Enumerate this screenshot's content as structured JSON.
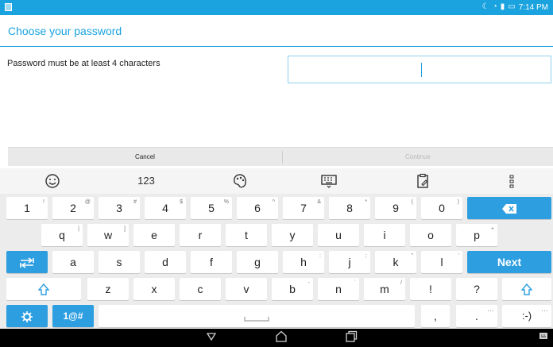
{
  "status_bar": {
    "time": "7:14 PM"
  },
  "header": {
    "title": "Choose your password"
  },
  "content": {
    "hint": "Password must be at least 4 characters"
  },
  "buttons": {
    "cancel": "Cancel",
    "continue": "Continue"
  },
  "keyboard": {
    "toolbar": {
      "numbers": "123"
    },
    "rows": {
      "numbers": [
        {
          "label": "1",
          "hint": "!"
        },
        {
          "label": "2",
          "hint": "@"
        },
        {
          "label": "3",
          "hint": "#"
        },
        {
          "label": "4",
          "hint": "$"
        },
        {
          "label": "5",
          "hint": "%"
        },
        {
          "label": "6",
          "hint": "^"
        },
        {
          "label": "7",
          "hint": "&"
        },
        {
          "label": "8",
          "hint": "*"
        },
        {
          "label": "9",
          "hint": "("
        },
        {
          "label": "0",
          "hint": ")"
        }
      ],
      "row2": [
        {
          "label": "q",
          "hint": "|"
        },
        {
          "label": "w",
          "hint": "]"
        },
        {
          "label": "e",
          "hint": ""
        },
        {
          "label": "r",
          "hint": ""
        },
        {
          "label": "t",
          "hint": ""
        },
        {
          "label": "y",
          "hint": ""
        },
        {
          "label": "u",
          "hint": ""
        },
        {
          "label": "i",
          "hint": ""
        },
        {
          "label": "o",
          "hint": ""
        },
        {
          "label": "p",
          "hint": "+"
        }
      ],
      "row3": [
        {
          "label": "a",
          "hint": ""
        },
        {
          "label": "s",
          "hint": ""
        },
        {
          "label": "d",
          "hint": ""
        },
        {
          "label": "f",
          "hint": ""
        },
        {
          "label": "g",
          "hint": ""
        },
        {
          "label": "h",
          "hint": ":"
        },
        {
          "label": "j",
          "hint": ";"
        },
        {
          "label": "k",
          "hint": "\""
        },
        {
          "label": "l",
          "hint": "'"
        }
      ],
      "row4": [
        {
          "label": "z",
          "hint": ""
        },
        {
          "label": "x",
          "hint": ""
        },
        {
          "label": "c",
          "hint": ""
        },
        {
          "label": "v",
          "hint": ""
        },
        {
          "label": "b",
          "hint": "-"
        },
        {
          "label": "n",
          "hint": "`"
        },
        {
          "label": "m",
          "hint": "/"
        },
        {
          "label": "!",
          "hint": ""
        },
        {
          "label": "?",
          "hint": ""
        }
      ]
    },
    "next_label": "Next",
    "symbols_label": "1@#",
    "comma_label": ",",
    "period_label": ".",
    "emoticon_label": ":-)"
  },
  "colors": {
    "accent": "#1aa3df",
    "key_blue": "#2d9ee0"
  },
  "icons": [
    "emoji-icon",
    "palette-icon",
    "keyboard-hide-icon",
    "clipboard-icon",
    "more-icon",
    "backspace-icon",
    "tab-icon",
    "shift-icon",
    "settings-icon",
    "back-icon",
    "home-icon",
    "recents-icon"
  ]
}
